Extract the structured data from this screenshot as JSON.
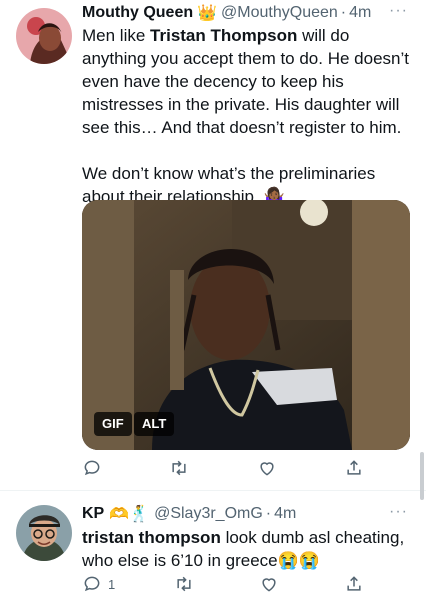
{
  "tweets": [
    {
      "display_name": "Mouthy Queen",
      "name_emoji": "👑",
      "handle": "@MouthyQueen",
      "separator": "·",
      "time": "4m",
      "more": "···",
      "text_1": "Men like ",
      "text_bold": "Tristan Thompson",
      "text_2": " will do anything you accept them to do. He doesn’t even have the decency to keep his mistresses in the private. His daughter will see this… And that doesn’t register to him.",
      "text_3": "We don’t know what’s the preliminaries about their relationship. 🤷🏾‍♀️",
      "media_badges": [
        "GIF",
        "ALT"
      ],
      "reply_count": "",
      "retweet_count": "",
      "like_count": ""
    },
    {
      "display_name": "KP",
      "name_emoji": "🫶🕺",
      "handle": "@Slay3r_OmG",
      "separator": "·",
      "time": "4m",
      "more": "···",
      "text_bold": "tristan thompson",
      "text_2": " look dumb asl cheating, who else is 6’10 in greece😭😭",
      "reply_count": "1",
      "retweet_count": "",
      "like_count": ""
    }
  ],
  "colors": {
    "text": "#0f1419",
    "secondary": "#536471",
    "divider": "#eff3f4"
  }
}
